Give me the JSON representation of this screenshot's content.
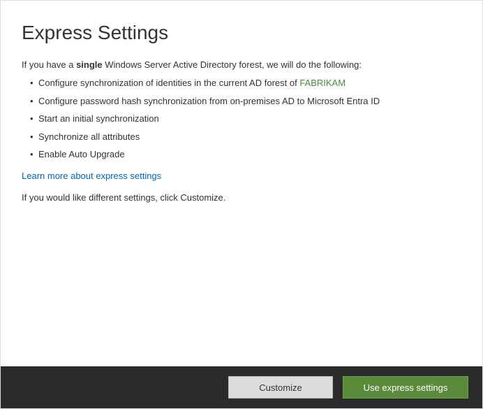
{
  "header": {
    "title": "Express Settings"
  },
  "intro": {
    "prefix": "If you have a ",
    "bold": "single",
    "suffix": " Windows Server Active Directory forest, we will do the following:"
  },
  "bullets": [
    {
      "prefix": "Configure synchronization of identities in the current AD forest of ",
      "forest": "FABRIKAM"
    },
    {
      "text": "Configure password hash synchronization from on-premises AD to Microsoft Entra ID"
    },
    {
      "text": "Start an initial synchronization"
    },
    {
      "text": "Synchronize all attributes"
    },
    {
      "text": "Enable Auto Upgrade"
    }
  ],
  "learn_more": "Learn more about express settings",
  "customize_hint": "If you would like different settings, click Customize.",
  "footer": {
    "customize_label": "Customize",
    "use_express_label": "Use express settings"
  }
}
